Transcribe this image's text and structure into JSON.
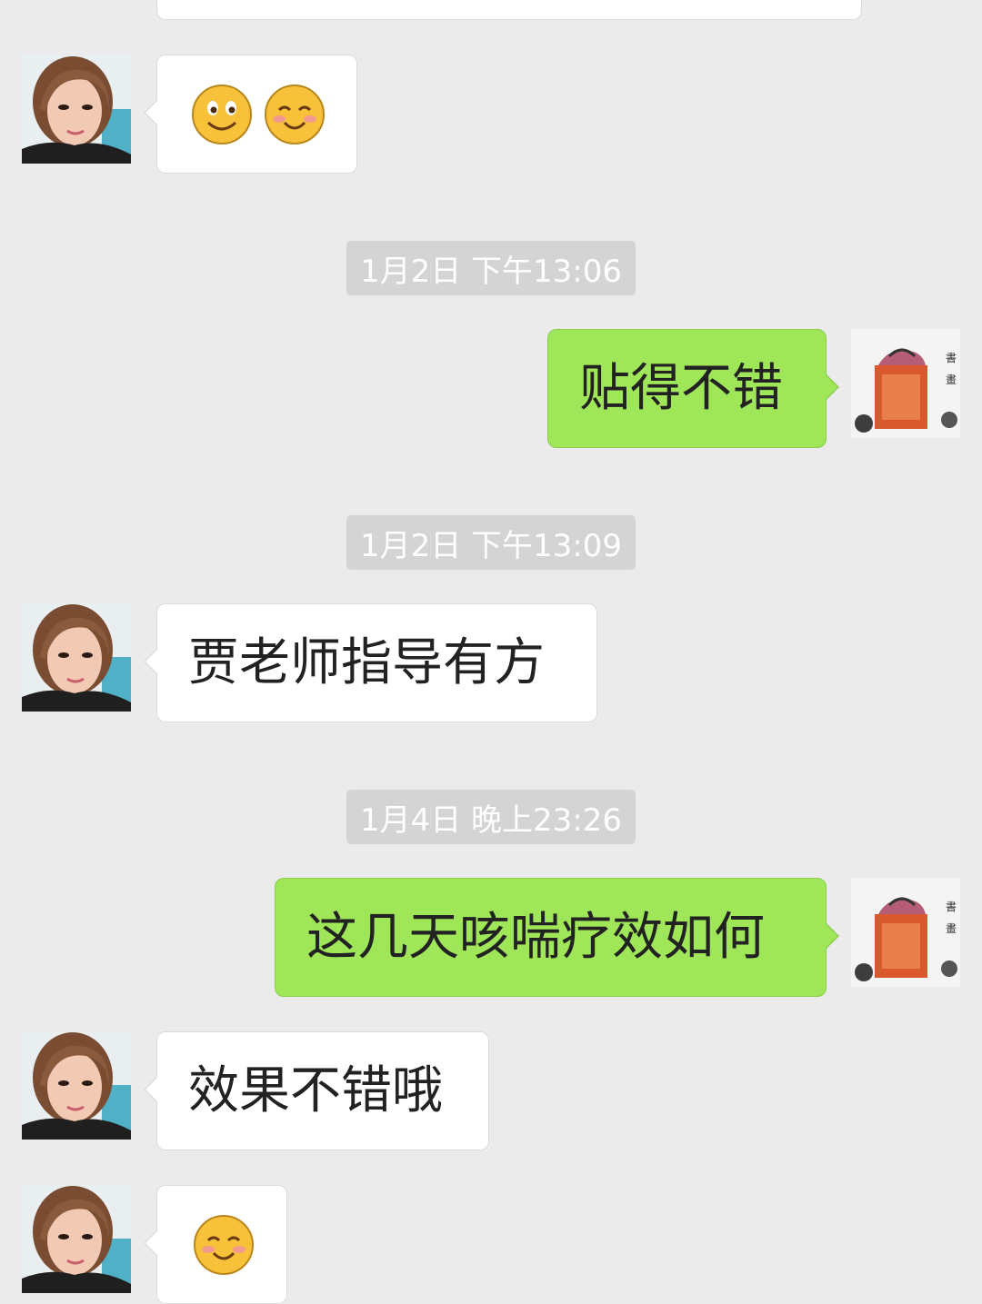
{
  "messages": {
    "m1": {
      "text": "贴得不错"
    },
    "m2": {
      "text": "贾老师指导有方"
    },
    "m3": {
      "text": "这几天咳喘疗效如何"
    },
    "m4": {
      "text": "效果不错哦"
    }
  },
  "timestamps": {
    "t1": "1月2日 下午13:06",
    "t2": "1月2日 下午13:09",
    "t3": "1月4日 晚上23:26"
  },
  "emoji": {
    "first_message": [
      "smile-emoji",
      "blush-emoji"
    ],
    "last_message": [
      "blush-emoji"
    ]
  },
  "avatars": {
    "contact": "contact-avatar",
    "self": "self-avatar-painting"
  },
  "colors": {
    "background": "#ebebeb",
    "sent_bubble": "#9fe658",
    "received_bubble": "#ffffff",
    "timestamp_bg": "#d4d4d4"
  }
}
